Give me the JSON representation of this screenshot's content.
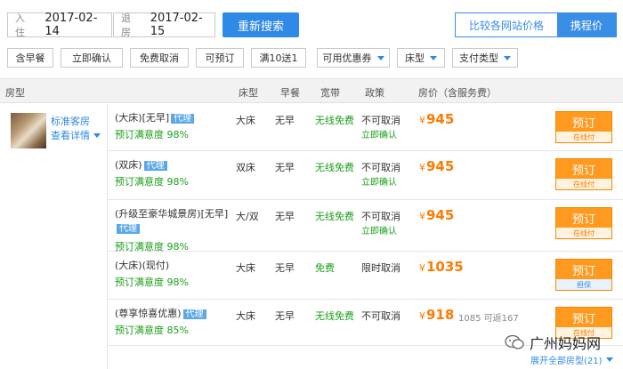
{
  "search": {
    "checkin_label": "入住",
    "checkin_date": "2017-02-14",
    "checkout_label": "退房",
    "checkout_date": "2017-02-15",
    "search_button": "重新搜索",
    "compare_label": "比较各网站价格",
    "ctrip_label": "携程价"
  },
  "filters": {
    "breakfast": "含早餐",
    "instant_confirm": "立即确认",
    "free_cancel": "免费取消",
    "bookable": "可预订",
    "promo": "满10送1",
    "coupon": "可用优惠券",
    "bed_type": "床型",
    "payment": "支付类型"
  },
  "table": {
    "headers": [
      "房型",
      "床型",
      "早餐",
      "宽带",
      "政策",
      "房价（含服务费）"
    ]
  },
  "room": {
    "name": "标准客房",
    "details": "查看详情"
  },
  "rates": [
    {
      "name": "(大床)[无早]",
      "agent": "代理",
      "satisfaction": "预订满意度 98%",
      "bed": "大床",
      "breakfast": "无早",
      "wifi": "无线免费",
      "policy": "不可取消",
      "confirm": "立即确认",
      "currency": "¥",
      "price": "945",
      "original": "",
      "book": "预订",
      "pay": "在线付",
      "pay_style": "orange"
    },
    {
      "name": "(双床)",
      "agent": "代理",
      "satisfaction": "预订满意度 98%",
      "bed": "双床",
      "breakfast": "无早",
      "wifi": "无线免费",
      "policy": "不可取消",
      "confirm": "立即确认",
      "currency": "¥",
      "price": "945",
      "original": "",
      "book": "预订",
      "pay": "在线付",
      "pay_style": "orange"
    },
    {
      "name": "(升级至豪华城景房)[无早]",
      "agent": "代理",
      "satisfaction": "预订满意度 98%",
      "bed": "大/双",
      "breakfast": "无早",
      "wifi": "无线免费",
      "policy": "不可取消",
      "confirm": "立即确认",
      "currency": "¥",
      "price": "945",
      "original": "",
      "book": "预订",
      "pay": "在线付",
      "pay_style": "orange"
    },
    {
      "name": "(大床)(现付)",
      "agent": "",
      "satisfaction": "预订满意度 98%",
      "bed": "大床",
      "breakfast": "无早",
      "wifi": "免费",
      "policy": "限时取消",
      "confirm": "",
      "currency": "¥",
      "price": "1035",
      "original": "",
      "book": "预订",
      "pay": "担保",
      "pay_style": "blue"
    },
    {
      "name": "(尊享惊喜优惠)",
      "agent": "代理",
      "satisfaction": "预订满意度 85%",
      "bed": "大床",
      "breakfast": "无早",
      "wifi": "无线免费",
      "policy": "不可取消",
      "confirm": "",
      "currency": "¥",
      "price": "918",
      "original": "1085 可返167",
      "book": "预订",
      "pay": "在线付",
      "pay_style": "orange"
    }
  ],
  "footer": {
    "watermark": "广州妈妈网",
    "expand_all": "展开全部房型(21)"
  }
}
